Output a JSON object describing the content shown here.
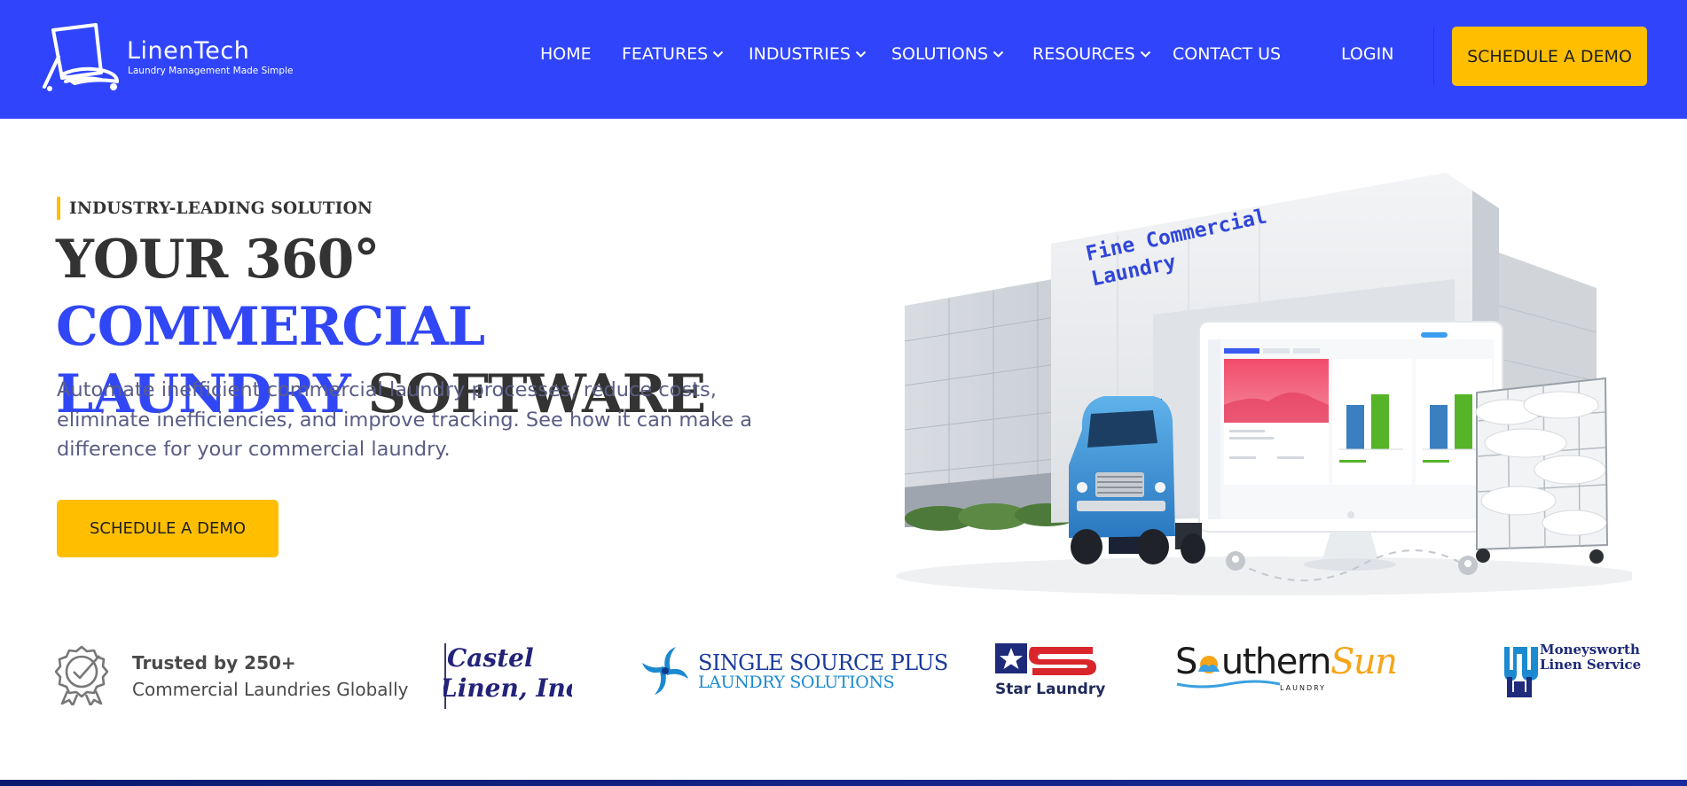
{
  "header": {
    "logo": {
      "name": "LinenTech",
      "tagline": "Laundry Management Made Simple"
    },
    "nav": [
      {
        "label": "HOME",
        "dropdown": false
      },
      {
        "label": "FEATURES",
        "dropdown": true
      },
      {
        "label": "INDUSTRIES",
        "dropdown": true
      },
      {
        "label": "SOLUTIONS",
        "dropdown": true
      },
      {
        "label": "RESOURCES",
        "dropdown": true
      },
      {
        "label": "CONTACT US",
        "dropdown": false
      }
    ],
    "login_label": "LOGIN",
    "demo_label": "SCHEDULE A DEMO"
  },
  "hero": {
    "eyebrow": "INDUSTRY-LEADING SOLUTION",
    "headline": {
      "part1": "YOUR 360° ",
      "part2_blue": "COMMERCIAL",
      "part3_blue": "LAUNDRY",
      "part4": " SOFTWARE"
    },
    "lead": "Automate inefficient commercial laundry processes, reduce costs, eliminate inefficiencies, and improve tracking. See how it can make a difference for your commercial laundry.",
    "cta_label": "SCHEDULE A DEMO",
    "illustration": {
      "building_sign_line1": "Fine Commercial",
      "building_sign_line2": "Laundry"
    }
  },
  "trust": {
    "bold": "Trusted by 250+",
    "sub": "Commercial Laundries Globally"
  },
  "clients": [
    {
      "name_line1": "Castel",
      "name_line2": "Linen, Inc."
    },
    {
      "name_line1": "SINGLE SOURCE PLUS",
      "name_line2": "LAUNDRY SOLUTIONS"
    },
    {
      "name_line1": "Star Laundry",
      "mark": "S"
    },
    {
      "name_part1": "S",
      "name_part2": "uthern",
      "name_part3": "Sun",
      "sub": "LAUNDRY"
    },
    {
      "name_line1": "Moneysworth",
      "name_line2": "Linen Service"
    }
  ],
  "colors": {
    "brand_blue": "#3045fb",
    "accent_yellow": "#ffbf00",
    "headline_dark": "#333333",
    "headline_blue": "#3147f5",
    "lead_text": "#5a5d84"
  },
  "icons": {
    "logo": "laundry-cart-logo-icon",
    "chevron": "chevron-down-icon",
    "badge": "award-check-badge-icon"
  }
}
